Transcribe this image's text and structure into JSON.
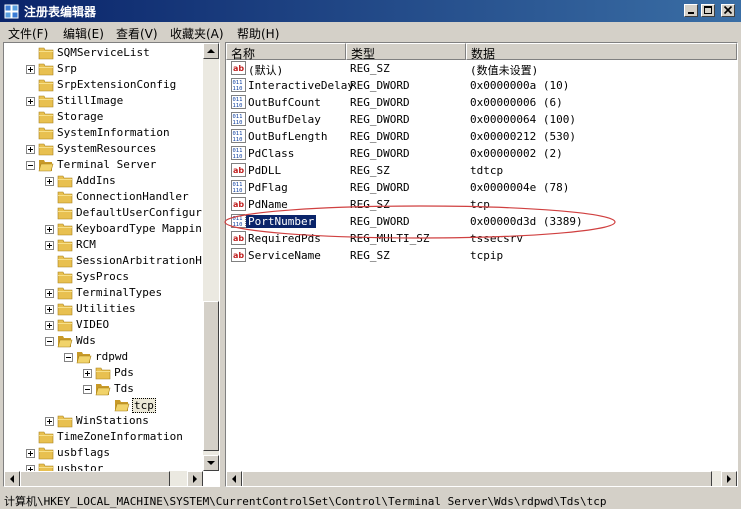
{
  "window": {
    "title": "注册表编辑器"
  },
  "menu": [
    "文件(F)",
    "编辑(E)",
    "查看(V)",
    "收藏夹(A)",
    "帮助(H)"
  ],
  "tree": [
    {
      "label": "SQMServiceList",
      "level": 0,
      "exp": "none"
    },
    {
      "label": "Srp",
      "level": 0,
      "exp": "plus"
    },
    {
      "label": "SrpExtensionConfig",
      "level": 0,
      "exp": "none"
    },
    {
      "label": "StillImage",
      "level": 0,
      "exp": "plus"
    },
    {
      "label": "Storage",
      "level": 0,
      "exp": "none"
    },
    {
      "label": "SystemInformation",
      "level": 0,
      "exp": "none"
    },
    {
      "label": "SystemResources",
      "level": 0,
      "exp": "plus"
    },
    {
      "label": "Terminal Server",
      "level": 0,
      "exp": "minus"
    },
    {
      "label": "AddIns",
      "level": 1,
      "exp": "plus"
    },
    {
      "label": "ConnectionHandler",
      "level": 1,
      "exp": "none"
    },
    {
      "label": "DefaultUserConfigur",
      "level": 1,
      "exp": "none"
    },
    {
      "label": "KeyboardType Mappin",
      "level": 1,
      "exp": "plus"
    },
    {
      "label": "RCM",
      "level": 1,
      "exp": "plus"
    },
    {
      "label": "SessionArbitrationH",
      "level": 1,
      "exp": "none"
    },
    {
      "label": "SysProcs",
      "level": 1,
      "exp": "none"
    },
    {
      "label": "TerminalTypes",
      "level": 1,
      "exp": "plus"
    },
    {
      "label": "Utilities",
      "level": 1,
      "exp": "plus"
    },
    {
      "label": "VIDEO",
      "level": 1,
      "exp": "plus"
    },
    {
      "label": "Wds",
      "level": 1,
      "exp": "minus"
    },
    {
      "label": "rdpwd",
      "level": 2,
      "exp": "minus"
    },
    {
      "label": "Pds",
      "level": 3,
      "exp": "plus"
    },
    {
      "label": "Tds",
      "level": 3,
      "exp": "minus"
    },
    {
      "label": "tcp",
      "level": 4,
      "exp": "none",
      "selected": true
    },
    {
      "label": "WinStations",
      "level": 1,
      "exp": "plus"
    },
    {
      "label": "TimeZoneInformation",
      "level": 0,
      "exp": "none"
    },
    {
      "label": "usbflags",
      "level": 0,
      "exp": "plus"
    },
    {
      "label": "usbstor",
      "level": 0,
      "exp": "plus"
    }
  ],
  "columns": [
    "名称",
    "类型",
    "数据"
  ],
  "values": [
    {
      "name": "(默认)",
      "type": "REG_SZ",
      "data": "(数值未设置)",
      "icon": "string"
    },
    {
      "name": "InteractiveDelay",
      "type": "REG_DWORD",
      "data": "0x0000000a (10)",
      "icon": "binary"
    },
    {
      "name": "OutBufCount",
      "type": "REG_DWORD",
      "data": "0x00000006 (6)",
      "icon": "binary"
    },
    {
      "name": "OutBufDelay",
      "type": "REG_DWORD",
      "data": "0x00000064 (100)",
      "icon": "binary"
    },
    {
      "name": "OutBufLength",
      "type": "REG_DWORD",
      "data": "0x00000212 (530)",
      "icon": "binary"
    },
    {
      "name": "PdClass",
      "type": "REG_DWORD",
      "data": "0x00000002 (2)",
      "icon": "binary"
    },
    {
      "name": "PdDLL",
      "type": "REG_SZ",
      "data": "tdtcp",
      "icon": "string"
    },
    {
      "name": "PdFlag",
      "type": "REG_DWORD",
      "data": "0x0000004e (78)",
      "icon": "binary"
    },
    {
      "name": "PdName",
      "type": "REG_SZ",
      "data": "tcp",
      "icon": "string"
    },
    {
      "name": "PortNumber",
      "type": "REG_DWORD",
      "data": "0x00000d3d (3389)",
      "icon": "binary",
      "selected": true
    },
    {
      "name": "RequiredPds",
      "type": "REG_MULTI_SZ",
      "data": "tssecsrv",
      "icon": "string"
    },
    {
      "name": "ServiceName",
      "type": "REG_SZ",
      "data": "tcpip",
      "icon": "string"
    }
  ],
  "status": "计算机\\HKEY_LOCAL_MACHINE\\SYSTEM\\CurrentControlSet\\Control\\Terminal Server\\Wds\\rdpwd\\Tds\\tcp",
  "colors": {
    "title_start": "#0a246a",
    "title_end": "#3a6ea5",
    "folder": "#e8c050",
    "highlight": "#0a246a",
    "annotation": "#d04040"
  }
}
